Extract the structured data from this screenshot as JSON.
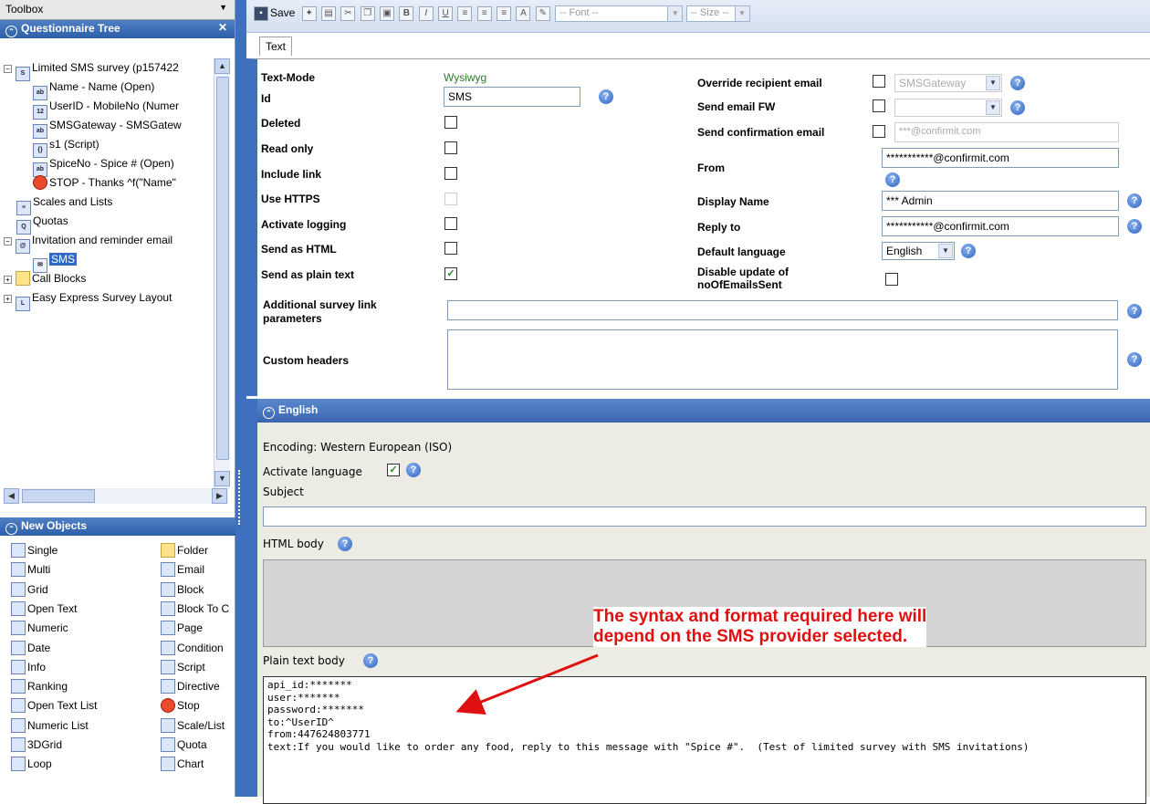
{
  "toolbox": {
    "title": "Toolbox"
  },
  "tree": {
    "title": "Questionnaire Tree",
    "items": [
      {
        "label": "Limited SMS survey (p157422",
        "icon": "survey-icon",
        "level": 0,
        "expander": "⊟"
      },
      {
        "label": "Name - Name (Open)",
        "icon": "open-text-icon",
        "level": 1
      },
      {
        "label": "UserID - MobileNo (Numer",
        "icon": "numeric-icon",
        "level": 1
      },
      {
        "label": "SMSGateway - SMSGatew",
        "icon": "open-text-icon",
        "level": 1
      },
      {
        "label": "s1 (Script)",
        "icon": "script-icon",
        "level": 1
      },
      {
        "label": "SpiceNo - Spice # (Open)",
        "icon": "open-text-icon",
        "level": 1
      },
      {
        "label": "STOP - Thanks ^f(\"Name\"",
        "icon": "stop-icon",
        "level": 1
      },
      {
        "label": "Scales and Lists",
        "icon": "scales-icon",
        "level": 0
      },
      {
        "label": "Quotas",
        "icon": "quotas-icon",
        "level": 0
      },
      {
        "label": "Invitation and reminder email",
        "icon": "invitation-icon",
        "level": 0,
        "expander": "⊟"
      },
      {
        "label": "SMS",
        "icon": "email-icon",
        "level": 1,
        "selected": true
      },
      {
        "label": "Call Blocks",
        "icon": "folder-icon",
        "level": 0,
        "expander": "⊞"
      },
      {
        "label": "Easy Express Survey Layout",
        "icon": "layout-icon",
        "level": 0,
        "expander": "⊞"
      }
    ]
  },
  "new_objects": {
    "title": "New Objects",
    "left": [
      "Single",
      "Multi",
      "Grid",
      "Open Text",
      "Numeric",
      "Date",
      "Info",
      "Ranking",
      "Open Text List",
      "Numeric List",
      "3DGrid",
      "Loop"
    ],
    "right": [
      "Folder",
      "Email",
      "Block",
      "Block To C",
      "Page",
      "Condition",
      "Script",
      "Directive",
      "Stop",
      "Scale/List",
      "Quota",
      "Chart"
    ]
  },
  "toolbar": {
    "save_label": "Save",
    "font_placeholder": "-- Font --",
    "size_placeholder": "-- Size --"
  },
  "tab": {
    "label": "Text"
  },
  "form": {
    "text_mode_label": "Text-Mode",
    "text_mode_value": "Wysiwyg",
    "id_label": "Id",
    "id_value": "SMS",
    "deleted_label": "Deleted",
    "read_only_label": "Read only",
    "include_link_label": "Include link",
    "use_https_label": "Use HTTPS",
    "activate_logging_label": "Activate logging",
    "send_html_label": "Send as HTML",
    "send_plain_label": "Send as plain text",
    "additional_params_label": "Additional survey link parameters",
    "custom_headers_label": "Custom headers",
    "override_label": "Override recipient email",
    "override_value": "SMSGateway",
    "send_fw_label": "Send email FW",
    "send_confirm_label": "Send confirmation email",
    "send_confirm_placeholder": "***@confirmit.com",
    "from_label": "From",
    "from_value": "***********@confirmit.com",
    "display_name_label": "Display Name",
    "display_name_value": "*** Admin",
    "reply_to_label": "Reply to",
    "reply_to_value": "***********@confirmit.com",
    "default_lang_label": "Default language",
    "default_lang_value": "English",
    "disable_update_label": "Disable update of noOfEmailsSent"
  },
  "language": {
    "title": "English",
    "encoding": "Encoding: Western European (ISO)",
    "activate_label": "Activate language",
    "subject_label": "Subject",
    "html_body_label": "HTML body",
    "plain_body_label": "Plain text body",
    "plain_lines": [
      "api_id:*******",
      "user:*******",
      "password:*******",
      "to:^UserID^",
      "from:447624803771",
      "text:If you would like to order any food, reply to this message with \"Spice #\".  (Test of limited survey with SMS invitations)"
    ]
  },
  "callout": {
    "line1": "The syntax and format required here will",
    "line2": "depend on the SMS provider selected.",
    "color": "#e01010"
  }
}
